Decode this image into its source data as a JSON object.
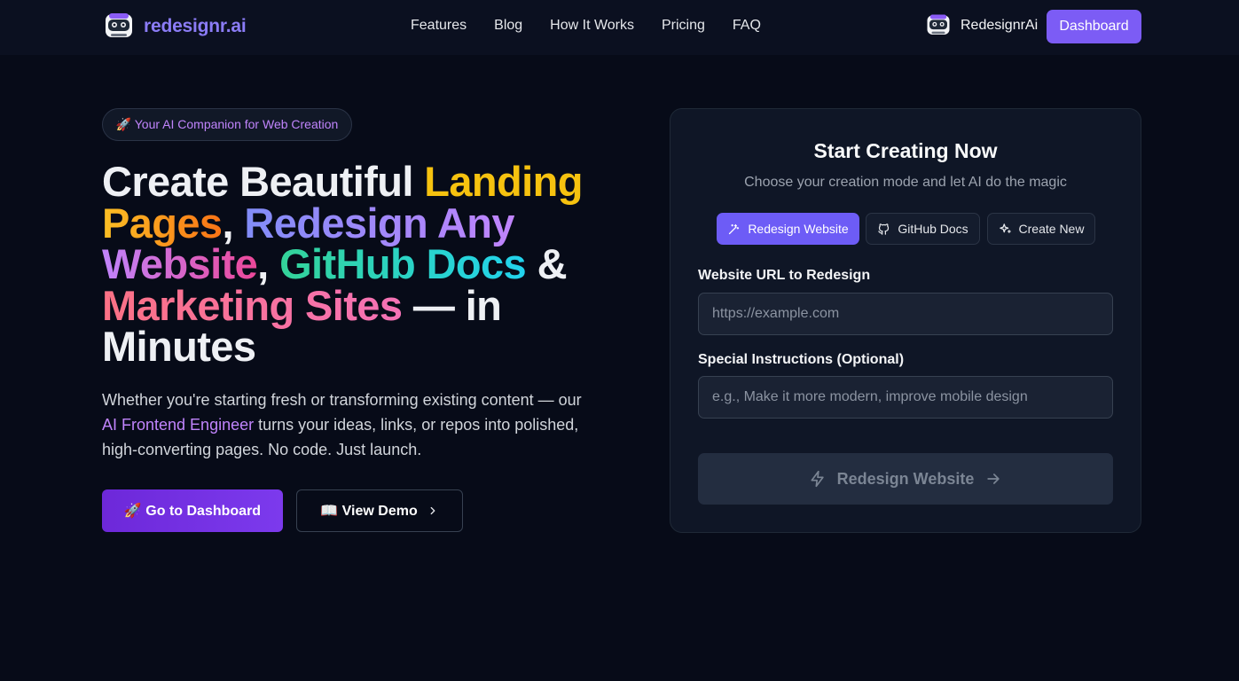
{
  "brand": {
    "name": "redesignr.ai"
  },
  "nav": {
    "links": [
      "Features",
      "Blog",
      "How It Works",
      "Pricing",
      "FAQ"
    ],
    "user_name": "RedesignrAi",
    "dashboard_label": "Dashboard"
  },
  "hero": {
    "badge": "🚀 Your AI Companion for Web Creation",
    "title": {
      "p1": "Create Beautiful ",
      "p2": "Landing",
      "p3": "Pages",
      "p4": ", ",
      "p5": "Redesign Any",
      "p6": "Website",
      "p7": ", ",
      "p8": "GitHub Docs",
      "p9": " &",
      "p10": "Marketing Sites",
      "p11": " — in",
      "p12": "Minutes"
    },
    "desc": {
      "p1": "Whether you're starting fresh or transforming existing content — our ",
      "p2": "AI Frontend Engineer",
      "p3": " turns your ideas, links, or repos into polished, high-converting pages. No code. Just launch."
    },
    "primary_cta": "🚀 Go to Dashboard",
    "secondary_cta": "📖 View Demo"
  },
  "card": {
    "title": "Start Creating Now",
    "subtitle": "Choose your creation mode and let AI do the magic",
    "tabs": [
      {
        "label": "Redesign Website",
        "active": true
      },
      {
        "label": "GitHub Docs",
        "active": false
      },
      {
        "label": "Create New",
        "active": false
      }
    ],
    "url_label": "Website URL to Redesign",
    "url_placeholder": "https://example.com",
    "instr_label": "Special Instructions (Optional)",
    "instr_placeholder": "e.g., Make it more modern, improve mobile design",
    "submit_label": "Redesign Website"
  },
  "colors": {
    "background": "#070b18",
    "accent": "#7c5cf5",
    "highlight_yellow": "#f6c20f",
    "highlight_teal": "#34d399",
    "highlight_rose": "#fb7185"
  },
  "icons": [
    "robot-logo-icon",
    "magic-wand-icon",
    "github-icon",
    "sparkles-icon",
    "lightning-icon",
    "arrow-right-icon",
    "chevron-right-icon"
  ]
}
